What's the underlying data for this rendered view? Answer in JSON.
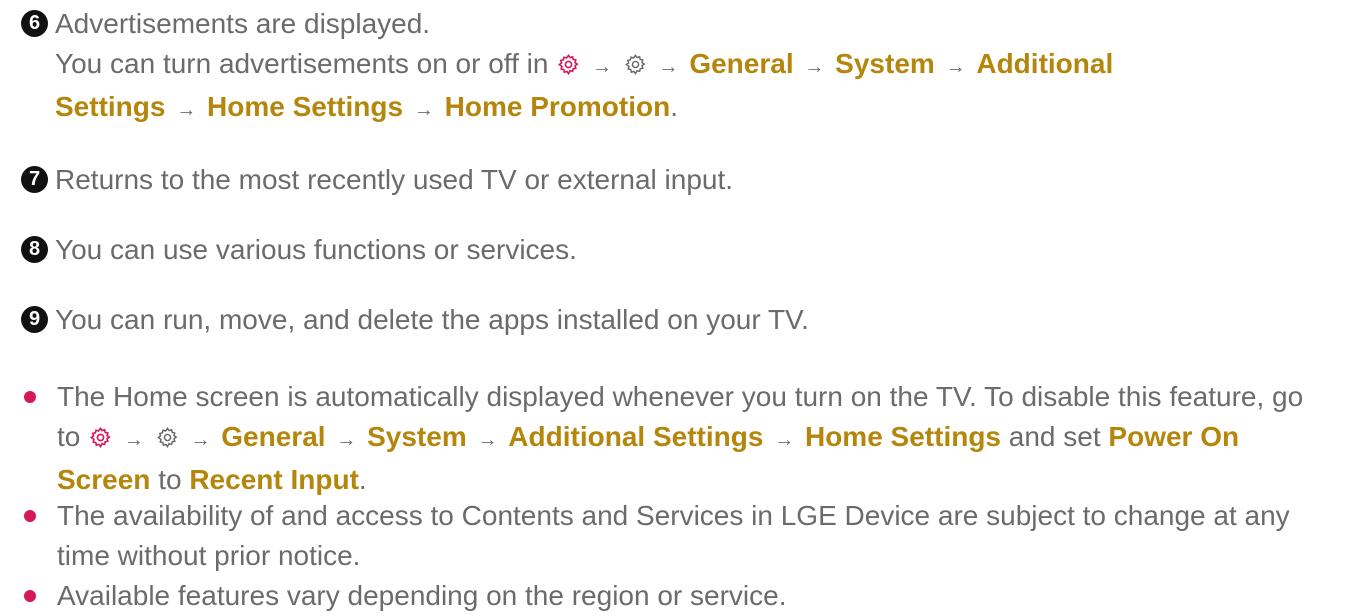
{
  "items": [
    {
      "number": "6",
      "line1": "Advertisements are displayed.",
      "line2_prefix": "You can turn advertisements on or off in",
      "path": [
        "General",
        "System",
        "Additional Settings",
        "Home Settings",
        "Home Promotion"
      ],
      "path_split_a": "Additional",
      "path_split_b": "Settings",
      "end": "."
    },
    {
      "number": "7",
      "text": "Returns to the most recently used TV or external input."
    },
    {
      "number": "8",
      "text": "You can use various functions or services."
    },
    {
      "number": "9",
      "text": "You can run, move, and delete the apps installed on your TV."
    }
  ],
  "bullets": [
    {
      "text_a": "The Home screen is automatically displayed whenever you turn on the TV. To disable this feature, go to",
      "path": [
        "General",
        "System",
        "Additional Settings",
        "Home Settings"
      ],
      "and_set": "and set",
      "setting": "Power On Screen",
      "to": "to",
      "value": "Recent Input",
      "end": "."
    },
    {
      "text": "The availability of and access to Contents and Services in LGE Device are subject to change at any time without prior notice."
    },
    {
      "text": "Available features vary depending on the region or service."
    }
  ],
  "icons": {
    "settings_quick": "settings-quick-gear-icon",
    "settings_all": "settings-all-gear-icon",
    "arrow": "→",
    "quick_color": "#d6175a",
    "all_color": "#666666"
  },
  "colors": {
    "text": "#6b6b6b",
    "highlight": "#b5860c",
    "bullet": "#d6175a",
    "badge": "#111111"
  }
}
